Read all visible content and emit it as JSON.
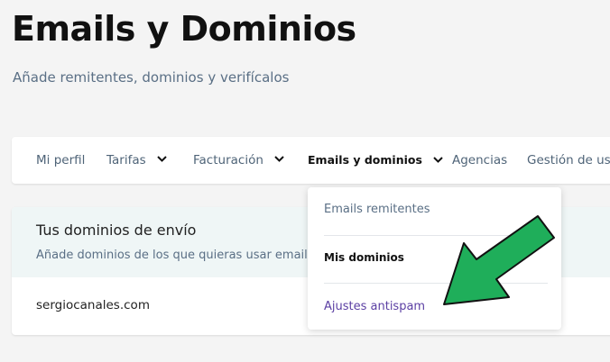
{
  "header": {
    "title": "Emails y Dominios",
    "subtitle": "Añade remitentes, dominios y verifícalos"
  },
  "nav": {
    "items": [
      {
        "label": "Mi perfil",
        "has_dropdown": false
      },
      {
        "label": "Tarifas",
        "has_dropdown": true
      },
      {
        "label": "Facturación",
        "has_dropdown": true
      },
      {
        "label": "Emails y dominios",
        "has_dropdown": true,
        "active": true
      },
      {
        "label": "Agencias",
        "has_dropdown": false
      },
      {
        "label": "Gestión de usu",
        "has_dropdown": false
      }
    ]
  },
  "dropdown": {
    "items": [
      {
        "label": "Emails remitentes",
        "color": "#5a6f85"
      },
      {
        "label": "Mis dominios",
        "color": "#111111",
        "selected": true
      },
      {
        "label": "Ajustes antispam",
        "color": "#5b3fa3"
      }
    ]
  },
  "domains_card": {
    "title": "Tus dominios de envío",
    "description": "Añade dominios de los que quieras usar emails",
    "rows": [
      "sergiocanales.com"
    ]
  },
  "annotation": {
    "icon": "arrow-icon",
    "color": "#1fae5a",
    "outline": "#111111"
  }
}
